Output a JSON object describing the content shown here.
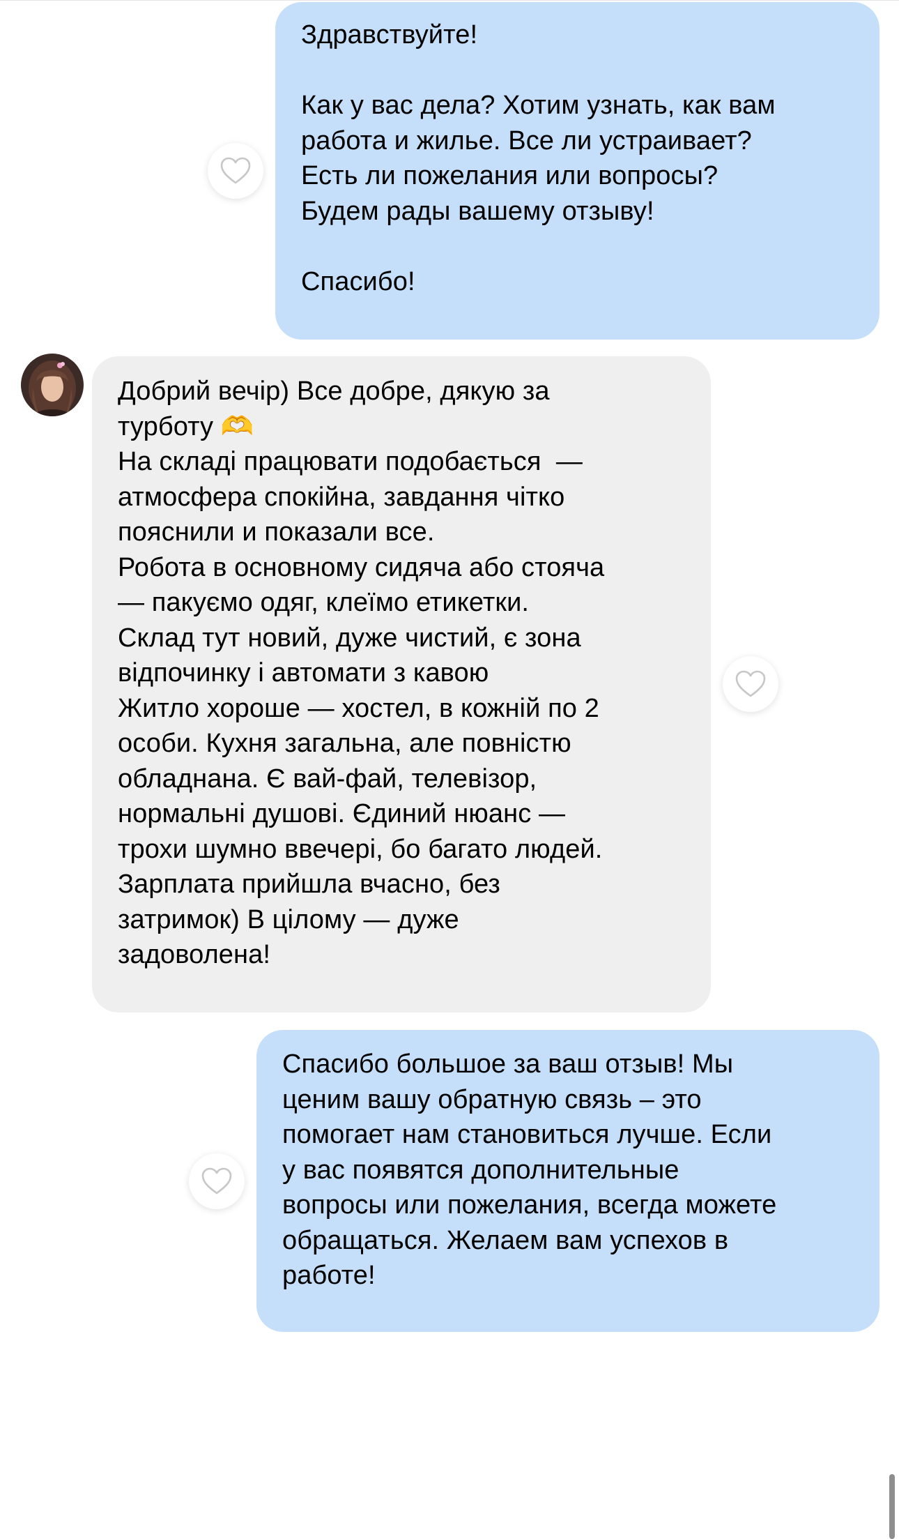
{
  "conversation": {
    "messages": [
      {
        "direction": "outgoing",
        "text": "Здравствуйте!\n\nКак у вас дела? Хотим узнать, как вам\nработа и жилье. Все ли устраивает?\nЕсть ли пожелания или вопросы?\nБудем рады вашему отзыву!\n\nСпасибо!"
      },
      {
        "direction": "incoming",
        "text": "Добрий вечір) Все добре, дякую за\nтурботу 🫶\nНа складі працювати подобається  —\nатмосфера спокійна, завдання чітко\nпояснили и показали все.\nРобота в основному сидяча або стояча\n— пакуємо одяг, клеїмо етикетки.\nСклад тут новий, дуже чистий, є зона\nвідпочинку і автомати з кавою\nЖитло хороше — хостел, в кожній по 2\nособи. Кухня загальна, але повністю\nобладнана. Є вай-фай, телевізор,\nнормальні душові. Єдиний нюанс —\nтрохи шумно ввечері, бо багато людей.\nЗарплата прийшла вчасно, без\nзатримок) В цілому — дуже\nзадоволена!"
      },
      {
        "direction": "outgoing",
        "text": "Спасибо большое за ваш отзыв! Мы\nценим вашу обратную связь – это\nпомогает нам становиться лучше. Если\nу вас появятся дополнительные\nвопросы или пожелания, всегда можете\nобращаться. Желаем вам успехов в\nработе!"
      }
    ]
  },
  "icons": {
    "like": "heart-outline-icon",
    "avatar": "user-avatar"
  },
  "colors": {
    "outgoing_bubble": "#c5dffb",
    "incoming_bubble": "#efefef",
    "background": "#ffffff",
    "heart_stroke": "#c7c7c7"
  }
}
